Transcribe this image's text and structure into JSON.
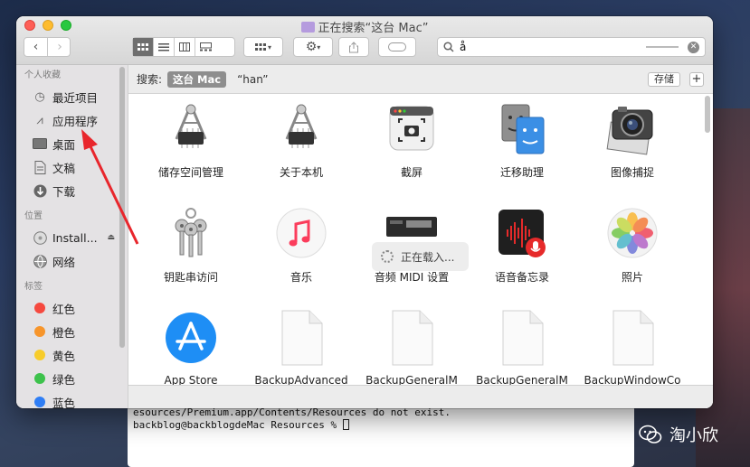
{
  "window": {
    "title": "正在搜索“这台 Mac”"
  },
  "toolbar": {
    "back_icon": "chevron-left-icon",
    "forward_icon": "chevron-right-icon",
    "search_query": "å"
  },
  "sidebar": {
    "favorites_header": "个人收藏",
    "favorites": [
      {
        "label": "最近项目",
        "icon": "clock-icon"
      },
      {
        "label": "应用程序",
        "icon": "applications-icon"
      },
      {
        "label": "桌面",
        "icon": "desktop-icon"
      },
      {
        "label": "文稿",
        "icon": "document-icon"
      },
      {
        "label": "下载",
        "icon": "download-icon"
      }
    ],
    "locations_header": "位置",
    "locations": [
      {
        "label": "Install...",
        "icon": "disk-icon"
      },
      {
        "label": "网络",
        "icon": "network-icon"
      }
    ],
    "tags_header": "标签",
    "tags": [
      {
        "label": "红色",
        "color": "#f5493f"
      },
      {
        "label": "橙色",
        "color": "#f7952b"
      },
      {
        "label": "黄色",
        "color": "#f7cc2b"
      },
      {
        "label": "绿色",
        "color": "#3dc24c"
      },
      {
        "label": "蓝色",
        "color": "#2f7ef5"
      }
    ]
  },
  "scopebar": {
    "search_label": "搜索:",
    "scope_this_mac": "这台 Mac",
    "scope_folder": "“han”",
    "save_label": "存储",
    "add_label": "+"
  },
  "results": [
    {
      "label": "储存空间管理",
      "icon": "storage-management-icon"
    },
    {
      "label": "关于本机",
      "icon": "about-this-mac-icon"
    },
    {
      "label": "截屏",
      "icon": "screenshot-icon"
    },
    {
      "label": "迁移助理",
      "icon": "migration-assistant-icon"
    },
    {
      "label": "图像捕捉",
      "icon": "image-capture-icon"
    },
    {
      "label": "钥匙串访问",
      "icon": "keychain-icon"
    },
    {
      "label": "音乐",
      "icon": "music-icon"
    },
    {
      "label": "音频 MIDI 设置",
      "icon": "audio-midi-icon"
    },
    {
      "label": "语音备忘录",
      "icon": "voice-memos-icon"
    },
    {
      "label": "照片",
      "icon": "photos-icon"
    },
    {
      "label": "App Store",
      "icon": "app-store-icon"
    },
    {
      "label": "BackupAdvanced",
      "icon": "file-icon"
    },
    {
      "label": "BackupGeneralM",
      "icon": "file-icon"
    },
    {
      "label": "BackupGeneralM",
      "icon": "file-icon"
    },
    {
      "label": "BackupWindowCo",
      "icon": "file-icon"
    }
  ],
  "loading_text": "正在载入...",
  "terminal": {
    "line1": "esources/Premium.app/Contents/Resources do not exist.",
    "line2": "backblog@backblogdeMac Resources % "
  },
  "watermark": "淘小欣"
}
